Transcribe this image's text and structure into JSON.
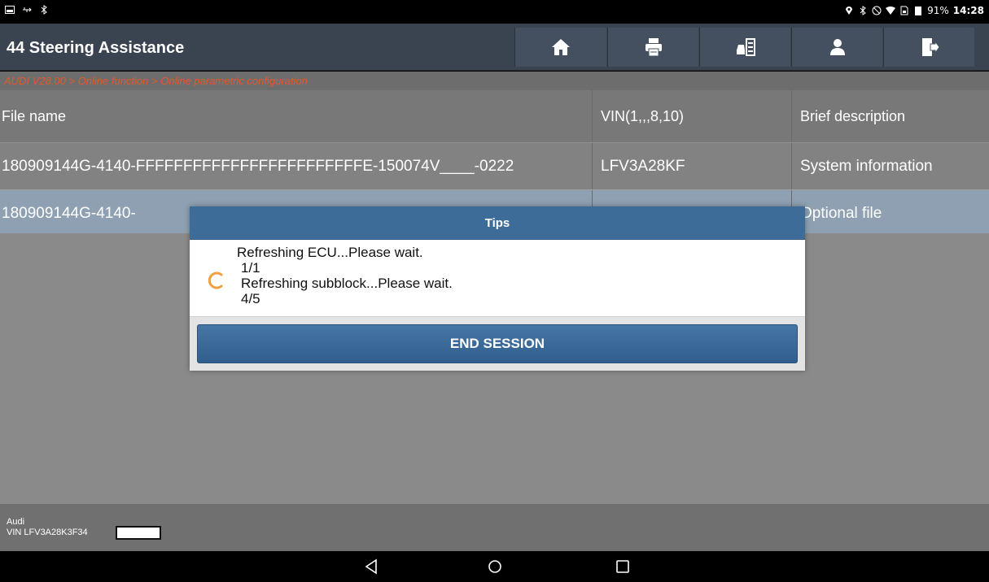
{
  "status_bar": {
    "left_icons": [
      "screenshot-icon",
      "usb-icon",
      "bluetooth-icon"
    ],
    "right_icons": [
      "location-icon",
      "bluetooth-icon",
      "block-icon",
      "wifi-icon",
      "sim-icon",
      "battery-icon"
    ],
    "battery": "91%",
    "time": "14:28"
  },
  "header": {
    "title": "44 Steering Assistance",
    "buttons": [
      "home-icon",
      "print-icon",
      "car-report-icon",
      "user-icon",
      "exit-icon"
    ]
  },
  "breadcrumb": "AUDI V28.00 > Online function > Online parametric configuration",
  "table": {
    "columns": [
      "File name",
      "VIN(1,,,8,10)",
      "Brief description"
    ],
    "rows": [
      [
        "180909144G-4140-FFFFFFFFFFFFFFFFFFFFFFFFE-150074V____-0222",
        "LFV3A28KF",
        "System information"
      ],
      [
        "180909144G-4140-",
        "",
        "Optional file"
      ]
    ]
  },
  "dialog": {
    "title": "Tips",
    "lines": [
      "Refreshing ECU...Please wait.",
      "1/1",
      "Refreshing subblock...Please wait.",
      "4/5"
    ],
    "button": "END SESSION"
  },
  "footer": {
    "make": "Audi",
    "vin": "VIN LFV3A28K3F34"
  },
  "colors": {
    "header_bg": "#3a4350",
    "breadcrumb_text": "#e4582e",
    "dialog_title_bg": "#3d6c99",
    "spinner": "#f0a040"
  }
}
